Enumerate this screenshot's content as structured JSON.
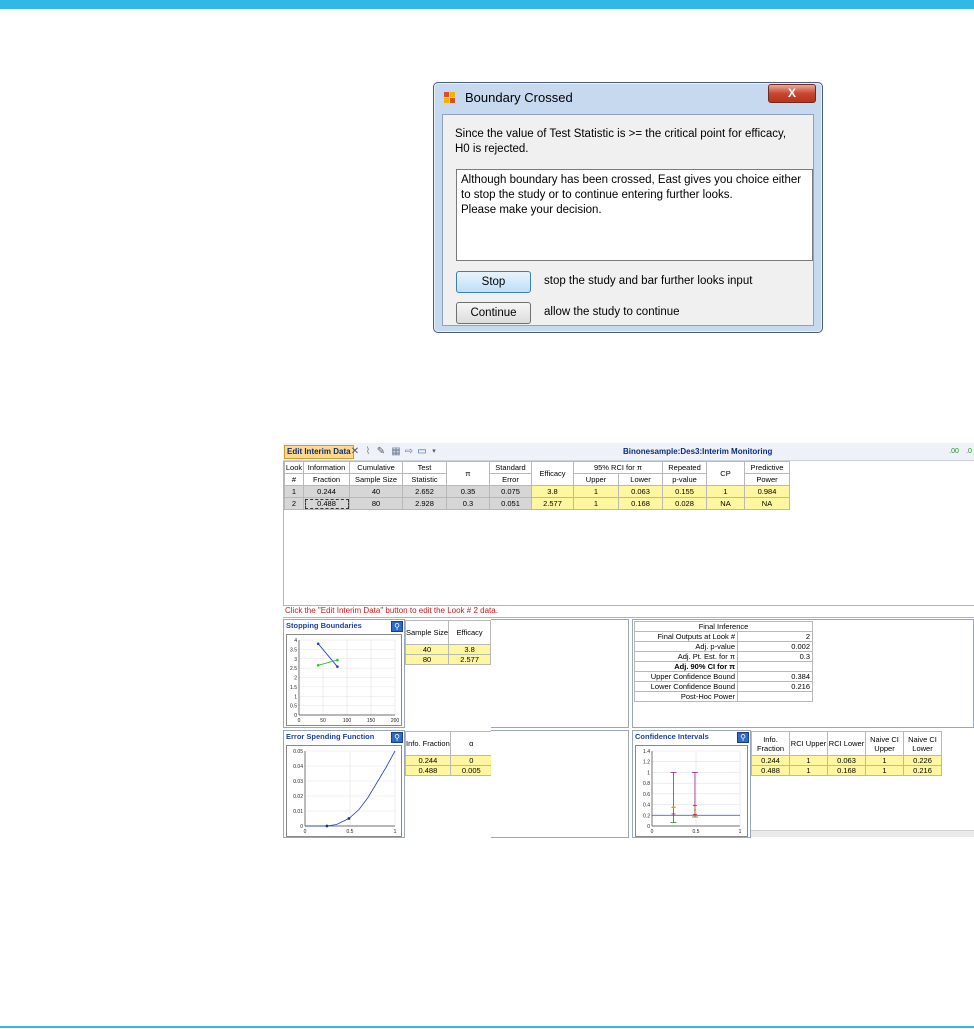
{
  "dialog": {
    "title": "Boundary Crossed",
    "close_label": "X",
    "message_lines": [
      "Since the value of Test Statistic is >= the critical point for efficacy,",
      "H0 is rejected."
    ],
    "info_lines": [
      "Although boundary has been crossed, East gives you choice either",
      "to stop the study or to continue entering further looks.",
      "Please make your decision."
    ],
    "stop_label": "Stop",
    "stop_desc": "stop the study and bar further looks input",
    "continue_label": "Continue",
    "continue_desc": "allow the study to continue"
  },
  "monitor": {
    "edit_button": "Edit Interim Data",
    "title": "Binonesample:Des3:Interim Monitoring",
    "toolbar_icons": [
      "close-icon",
      "chart-icon",
      "edit-icon",
      "table-icon",
      "export-icon",
      "save-icon",
      "dropdown-icon"
    ],
    "right_icons": [
      "decimal-increase-icon",
      "decimal-decrease-icon"
    ],
    "table": {
      "headers_top": [
        "Look",
        "Information",
        "Cumulative",
        "Test",
        "π",
        "Standard",
        "Efficacy",
        "95% RCI for π",
        "Repeated",
        "CP",
        "Predictive"
      ],
      "headers_bottom": [
        "#",
        "Fraction",
        "Sample Size",
        "Statistic",
        "Error",
        "Upper",
        "Lower",
        "p-value",
        "Power"
      ],
      "rows": [
        {
          "look": "1",
          "info": "0.244",
          "size": "40",
          "stat": "2.652",
          "pi": "0.35",
          "se": "0.075",
          "eff": "3.8",
          "upper": "1",
          "lower": "0.063",
          "pval": "0.155",
          "cp": "1",
          "pp": "0.984"
        },
        {
          "look": "2",
          "info": "0.488",
          "size": "80",
          "stat": "2.928",
          "pi": "0.3",
          "se": "0.051",
          "eff": "2.577",
          "upper": "1",
          "lower": "0.168",
          "pval": "0.028",
          "cp": "NA",
          "pp": "NA"
        }
      ]
    },
    "hint": "Click the \"Edit Interim Data\" button to edit the Look # 2 data.",
    "stopping": {
      "title": "Stopping Boundaries",
      "headers": [
        "Sample Size",
        "Efficacy"
      ],
      "rows": [
        [
          "40",
          "3.8"
        ],
        [
          "80",
          "2.577"
        ]
      ]
    },
    "final_inference": {
      "title": "Final Inference",
      "rows": [
        {
          "label": "Final Outputs at Look #",
          "value": "2"
        },
        {
          "label": "Adj. p-value",
          "value": "0.002"
        },
        {
          "label": "Adj. Pt. Est. for π",
          "value": "0.3"
        },
        {
          "label": "Adj. 90% CI for π",
          "value": ""
        },
        {
          "label": "Upper Confidence Bound",
          "value": "0.384"
        },
        {
          "label": "Lower Confidence Bound",
          "value": "0.216"
        },
        {
          "label": "Post-Hoc Power",
          "value": ""
        }
      ]
    },
    "error_spending": {
      "title": "Error Spending Function",
      "headers": [
        "Info. Fraction",
        "α"
      ],
      "rows": [
        [
          "0.244",
          "0"
        ],
        [
          "0.488",
          "0.005"
        ]
      ]
    },
    "confidence": {
      "title": "Confidence Intervals",
      "headers": [
        "Info. Fraction",
        "RCI Upper",
        "RCI Lower",
        "Naive CI Upper",
        "Naive CI Lower"
      ],
      "rows": [
        [
          "0.244",
          "1",
          "0.063",
          "1",
          "0.226"
        ],
        [
          "0.488",
          "1",
          "0.168",
          "1",
          "0.216"
        ]
      ]
    }
  },
  "chart_data": [
    {
      "type": "line",
      "title": "",
      "xlim": [
        0,
        200
      ],
      "ylim": [
        0,
        4
      ],
      "x_ticks": [
        "0",
        "50",
        "100",
        "150",
        "200"
      ],
      "y_ticks": [
        "0",
        "0.5",
        "1",
        "1.5",
        "2",
        "2.5",
        "3",
        "3.5",
        "4"
      ],
      "series": [
        {
          "color": "#1f3fd0",
          "x": [
            40,
            80
          ],
          "y": [
            3.8,
            2.577
          ]
        },
        {
          "color": "#2ec42e",
          "x": [
            40,
            80
          ],
          "y": [
            2.652,
            2.928
          ]
        }
      ]
    },
    {
      "type": "line",
      "title": "",
      "xlim": [
        0,
        1
      ],
      "ylim": [
        0,
        0.05
      ],
      "x_ticks": [
        "0",
        "0.5",
        "1"
      ],
      "y_ticks": [
        "0",
        "0.01",
        "0.02",
        "0.03",
        "0.04",
        "0.05"
      ],
      "series": [
        {
          "color": "#1f3fd0",
          "x": [
            0,
            0.244,
            0.35,
            0.488,
            0.6,
            0.7,
            0.8,
            0.9,
            1.0
          ],
          "y": [
            0,
            0,
            0.001,
            0.005,
            0.011,
            0.019,
            0.029,
            0.039,
            0.05
          ]
        }
      ],
      "points": [
        [
          0.244,
          0
        ],
        [
          0.488,
          0.005
        ]
      ]
    },
    {
      "type": "scatter",
      "title": "",
      "xlim": [
        0,
        1
      ],
      "ylim": [
        0,
        1.4
      ],
      "x_ticks": [
        "0",
        "0.5",
        "1"
      ],
      "y_ticks": [
        "0",
        "0.2",
        "0.4",
        "0.6",
        "0.8",
        "1",
        "1.2",
        "1.4"
      ],
      "intervals": [
        {
          "x": 0.244,
          "rci_upper": 1,
          "rci_lower": 0.063,
          "naive_upper": 0.35,
          "naive_lower": 0.226,
          "estimate": 0.35
        },
        {
          "x": 0.488,
          "rci_upper": 1,
          "rci_lower": 0.168,
          "naive_upper": 0.384,
          "naive_lower": 0.216,
          "estimate": 0.3
        }
      ],
      "reference_y": 0.2
    }
  ]
}
